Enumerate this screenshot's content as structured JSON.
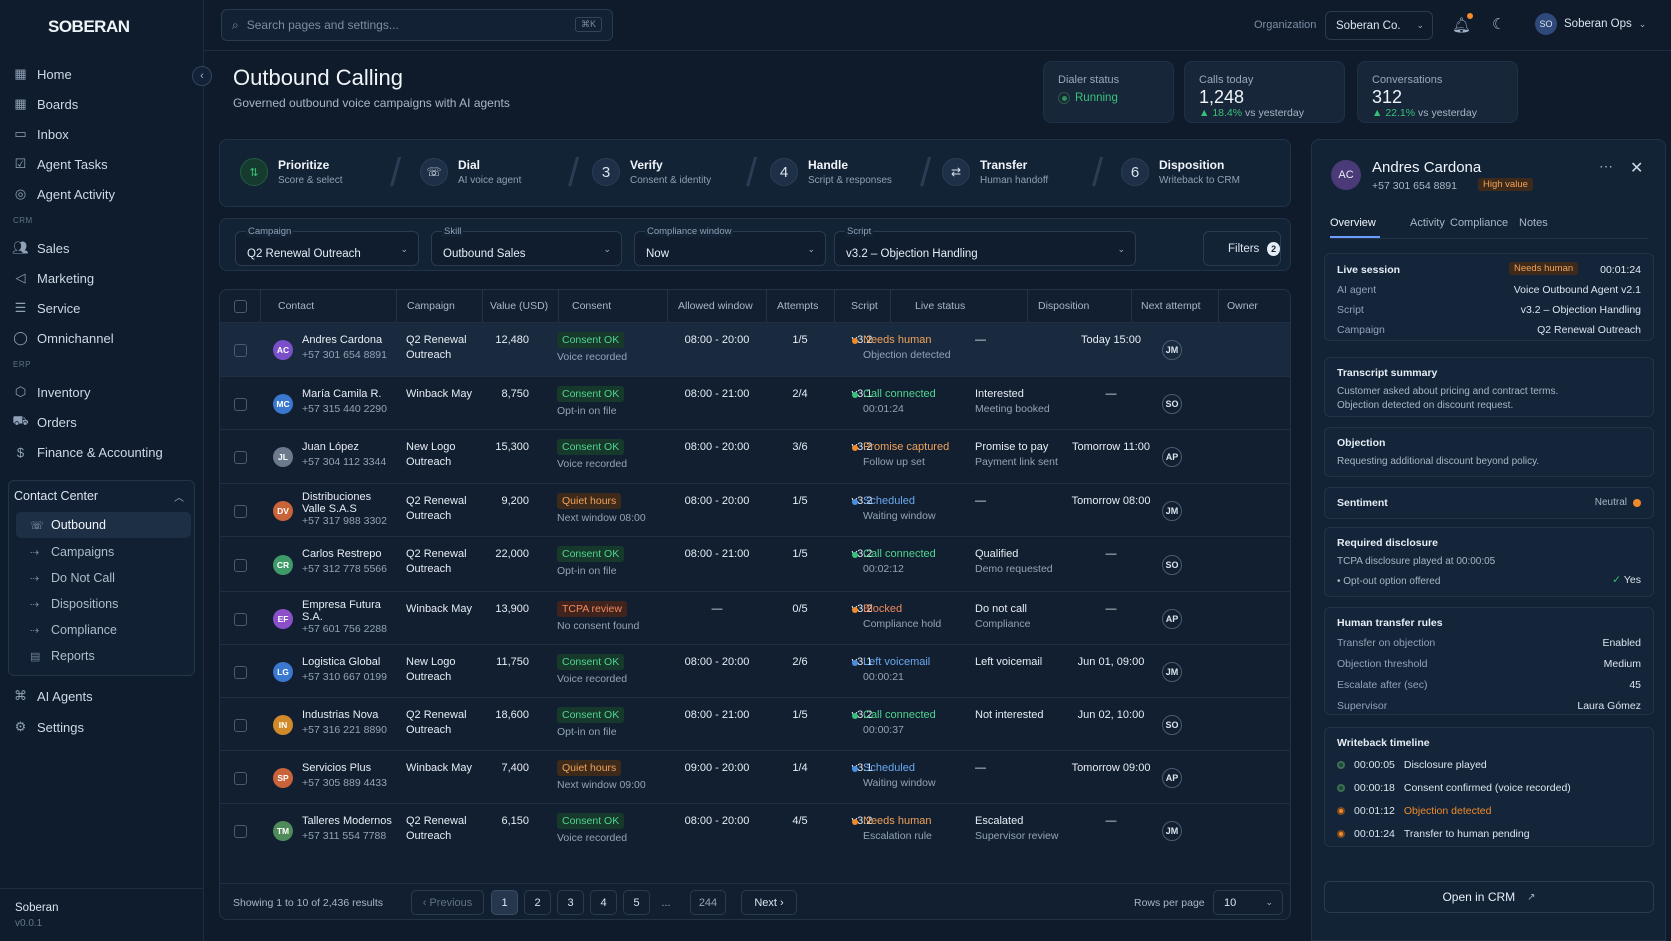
{
  "app": {
    "logo": "SOBERAN"
  },
  "sidebar": {
    "items": [
      {
        "label": "Home",
        "icon": "grid-icon"
      },
      {
        "label": "Boards",
        "icon": "board-icon"
      },
      {
        "label": "Inbox",
        "icon": "inbox-icon"
      },
      {
        "label": "Agent Tasks",
        "icon": "tasks-icon"
      },
      {
        "label": "Agent Activity",
        "icon": "activity-icon"
      }
    ],
    "crm_label": "CRM",
    "crm_items": [
      {
        "label": "Sales"
      },
      {
        "label": "Marketing"
      },
      {
        "label": "Service"
      },
      {
        "label": "Omnichannel"
      }
    ],
    "erp_label": "ERP",
    "erp_items": [
      {
        "label": "Inventory"
      },
      {
        "label": "Orders"
      },
      {
        "label": "Finance & Accounting"
      }
    ],
    "contact_center": {
      "label": "Contact Center",
      "items": [
        {
          "label": "Outbound"
        },
        {
          "label": "Campaigns"
        },
        {
          "label": "Do Not Call"
        },
        {
          "label": "Dispositions"
        },
        {
          "label": "Compliance"
        },
        {
          "label": "Reports"
        }
      ]
    },
    "bottom_items": [
      {
        "label": "AI Agents"
      },
      {
        "label": "Settings"
      }
    ],
    "footer": {
      "name": "Soberan",
      "version": "v0.0.1"
    }
  },
  "topbar": {
    "search_placeholder": "Search pages and settings...",
    "kbd": "⌘K",
    "org_label": "Organization",
    "org_value": "Soberan Co.",
    "user_initials": "SO",
    "user_name": "Soberan Ops"
  },
  "header": {
    "title": "Outbound Calling",
    "subtitle": "Governed outbound voice campaigns with AI agents",
    "dialer": {
      "label": "Dialer status",
      "value": "Running"
    },
    "calls": {
      "label": "Calls today",
      "value": "1,248",
      "delta": "18.4%",
      "delta_text": "vs yesterday"
    },
    "conversations": {
      "label": "Conversations",
      "value": "312",
      "delta": "22.1%",
      "delta_text": "vs yesterday"
    }
  },
  "steps": [
    {
      "num": "",
      "title": "Prioritize",
      "sub": "Score & select"
    },
    {
      "num": "",
      "title": "Dial",
      "sub": "AI voice agent"
    },
    {
      "num": "3",
      "title": "Verify",
      "sub": "Consent & identity"
    },
    {
      "num": "4",
      "title": "Handle",
      "sub": "Script & responses"
    },
    {
      "num": "",
      "title": "Transfer",
      "sub": "Human handoff"
    },
    {
      "num": "6",
      "title": "Disposition",
      "sub": "Writeback to CRM"
    }
  ],
  "filters": {
    "campaign": {
      "label": "Campaign",
      "value": "Q2 Renewal Outreach"
    },
    "skill": {
      "label": "Skill",
      "value": "Outbound Sales"
    },
    "window": {
      "label": "Compliance window",
      "value": "Now"
    },
    "script": {
      "label": "Script",
      "value": "v3.2 – Objection Handling"
    },
    "button": "Filters",
    "count": "2"
  },
  "table": {
    "headers": [
      "Contact",
      "Campaign",
      "Value (USD)",
      "Consent",
      "Allowed window",
      "Attempts",
      "Script",
      "Live status",
      "Disposition",
      "Next attempt",
      "Owner"
    ],
    "rows": [
      {
        "ini": "AC",
        "avc": "#7a4fc9",
        "name": "Andres Cardona",
        "name2": "",
        "phone": "+57 301 654 8891",
        "camp1": "Q2 Renewal",
        "camp2": "Outreach",
        "value": "12,480",
        "consent": "Consent OK",
        "ctype": "ok",
        "csub": "Voice recorded",
        "window": "08:00 - 20:00",
        "att": "1/5",
        "script": "v3.2",
        "status": "Needs human",
        "sc": "#f08a2b",
        "scol": "#f0a25a",
        "ssub": "Objection detected",
        "disp": "—",
        "dsub": "",
        "next": "Today 15:00",
        "owner": "JM"
      },
      {
        "ini": "MC",
        "avc": "#3a78d0",
        "name": "María Camila R.",
        "name2": "",
        "phone": "+57 315 440 2290",
        "camp1": "Winback May",
        "camp2": "",
        "value": "8,750",
        "consent": "Consent OK",
        "ctype": "ok",
        "csub": "Opt-in on file",
        "window": "08:00 - 21:00",
        "att": "2/4",
        "script": "v3.1",
        "status": "Call connected",
        "sc": "#39c07a",
        "scol": "#4fd48f",
        "ssub": "00:01:24",
        "disp": "Interested",
        "dsub": "Meeting booked",
        "next": "—",
        "owner": "SO"
      },
      {
        "ini": "JL",
        "avc": "#6b7a8c",
        "name": "Juan López",
        "name2": "",
        "phone": "+57 304 112 3344",
        "camp1": "New Logo",
        "camp2": "Outreach",
        "value": "15,300",
        "consent": "Consent OK",
        "ctype": "ok",
        "csub": "Voice recorded",
        "window": "08:00 - 20:00",
        "att": "3/6",
        "script": "v3.2",
        "status": "Promise captured",
        "sc": "#f08a2b",
        "scol": "#f0a25a",
        "ssub": "Follow up set",
        "disp": "Promise to pay",
        "dsub": "Payment link sent",
        "next": "Tomorrow 11:00",
        "owner": "AP"
      },
      {
        "ini": "DV",
        "avc": "#c9633a",
        "name": "Distribuciones",
        "name2": "Valle S.A.S",
        "phone": "+57 317 988 3302",
        "camp1": "Q2 Renewal",
        "camp2": "Outreach",
        "value": "9,200",
        "consent": "Quiet hours",
        "ctype": "warn",
        "csub": "Next window 08:00",
        "window": "08:00 - 20:00",
        "att": "1/5",
        "script": "v3.2",
        "status": "Scheduled",
        "sc": "#4a90e2",
        "scol": "#6aa8f0",
        "ssub": "Waiting window",
        "disp": "—",
        "dsub": "",
        "next": "Tomorrow 08:00",
        "owner": "JM"
      },
      {
        "ini": "CR",
        "avc": "#3f9a6a",
        "name": "Carlos Restrepo",
        "name2": "",
        "phone": "+57 312 778 5566",
        "camp1": "Q2 Renewal",
        "camp2": "Outreach",
        "value": "22,000",
        "consent": "Consent OK",
        "ctype": "ok",
        "csub": "Opt-in on file",
        "window": "08:00 - 21:00",
        "att": "1/5",
        "script": "v3.2",
        "status": "Call connected",
        "sc": "#39c07a",
        "scol": "#4fd48f",
        "ssub": "00:02:12",
        "disp": "Qualified",
        "dsub": "Demo requested",
        "next": "—",
        "owner": "SO"
      },
      {
        "ini": "EF",
        "avc": "#8a4fc9",
        "name": "Empresa Futura",
        "name2": "S.A.",
        "phone": "+57 601 756 2288",
        "camp1": "Winback May",
        "camp2": "",
        "value": "13,900",
        "consent": "TCPA review",
        "ctype": "err",
        "csub": "No consent found",
        "window": "—",
        "att": "0/5",
        "script": "v3.2",
        "status": "Blocked",
        "sc": "#f08a2b",
        "scol": "#f08a5c",
        "ssub": "Compliance hold",
        "disp": "Do not call",
        "dsub": "Compliance",
        "next": "—",
        "owner": "AP"
      },
      {
        "ini": "LG",
        "avc": "#3a78d0",
        "name": "Logistica Global",
        "name2": "",
        "phone": "+57 310 667 0199",
        "camp1": "New Logo",
        "camp2": "Outreach",
        "value": "11,750",
        "consent": "Consent OK",
        "ctype": "ok",
        "csub": "Voice recorded",
        "window": "08:00 - 20:00",
        "att": "2/6",
        "script": "v3.1",
        "status": "Left voicemail",
        "sc": "#4a90e2",
        "scol": "#6aa8f0",
        "ssub": "00:00:21",
        "disp": "Left voicemail",
        "dsub": "",
        "next": "Jun 01, 09:00",
        "owner": "JM"
      },
      {
        "ini": "IN",
        "avc": "#d08a2a",
        "name": "Industrias Nova",
        "name2": "",
        "phone": "+57 316 221 8890",
        "camp1": "Q2 Renewal",
        "camp2": "Outreach",
        "value": "18,600",
        "consent": "Consent OK",
        "ctype": "ok",
        "csub": "Opt-in on file",
        "window": "08:00 - 21:00",
        "att": "1/5",
        "script": "v3.2",
        "status": "Call connected",
        "sc": "#39c07a",
        "scol": "#4fd48f",
        "ssub": "00:00:37",
        "disp": "Not interested",
        "dsub": "",
        "next": "Jun 02, 10:00",
        "owner": "SO"
      },
      {
        "ini": "SP",
        "avc": "#c9633a",
        "name": "Servicios Plus",
        "name2": "",
        "phone": "+57 305 889 4433",
        "camp1": "Winback May",
        "camp2": "",
        "value": "7,400",
        "consent": "Quiet hours",
        "ctype": "warn",
        "csub": "Next window 09:00",
        "window": "09:00 - 20:00",
        "att": "1/4",
        "script": "v3.1",
        "status": "Scheduled",
        "sc": "#4a90e2",
        "scol": "#6aa8f0",
        "ssub": "Waiting window",
        "disp": "—",
        "dsub": "",
        "next": "Tomorrow 09:00",
        "owner": "AP"
      },
      {
        "ini": "TM",
        "avc": "#4f8a5a",
        "name": "Talleres Modernos",
        "name2": "",
        "phone": "+57 311 554 7788",
        "camp1": "Q2 Renewal",
        "camp2": "Outreach",
        "value": "6,150",
        "consent": "Consent OK",
        "ctype": "ok",
        "csub": "Voice recorded",
        "window": "08:00 - 20:00",
        "att": "4/5",
        "script": "v3.2",
        "status": "Needs human",
        "sc": "#f08a2b",
        "scol": "#f0a25a",
        "ssub": "Escalation rule",
        "disp": "Escalated",
        "dsub": "Supervisor review",
        "next": "—",
        "owner": "JM"
      }
    ],
    "footer_text": "Showing 1 to 10 of 2,436 results",
    "prev": "Previous",
    "pages": [
      "1",
      "2",
      "3",
      "4",
      "5",
      "...",
      "244"
    ],
    "next": "Next",
    "rows_label": "Rows per page",
    "rows_value": "10"
  },
  "panel": {
    "initials": "AC",
    "name": "Andres Cardona",
    "phone": "+57 301 654 8891",
    "badge": "High value",
    "tabs": [
      "Overview",
      "Activity",
      "Compliance",
      "Notes"
    ],
    "live": {
      "title": "Live session",
      "badge": "Needs human",
      "time": "00:01:24",
      "rows": [
        {
          "k": "AI agent",
          "v": "Voice Outbound Agent v2.1"
        },
        {
          "k": "Script",
          "v": "v3.2 – Objection Handling"
        },
        {
          "k": "Campaign",
          "v": "Q2 Renewal Outreach"
        }
      ]
    },
    "transcript": {
      "title": "Transcript summary",
      "line1": "Customer asked about pricing and contract terms.",
      "line2": "Objection detected on discount request."
    },
    "objection": {
      "title": "Objection",
      "text": "Requesting additional discount beyond policy."
    },
    "sentiment": {
      "title": "Sentiment",
      "value": "Neutral"
    },
    "disclosure": {
      "title": "Required disclosure",
      "line1": "TCPA disclosure played at 00:00:05",
      "line2": "Opt-out option offered",
      "value": "Yes"
    },
    "transfer": {
      "title": "Human transfer rules",
      "rows": [
        {
          "k": "Transfer on objection",
          "v": "Enabled"
        },
        {
          "k": "Objection threshold",
          "v": "Medium"
        },
        {
          "k": "Escalate after (sec)",
          "v": "45"
        },
        {
          "k": "Supervisor",
          "v": "Laura Gómez"
        }
      ]
    },
    "timeline": {
      "title": "Writeback timeline",
      "items": [
        {
          "t": "00:00:05",
          "text": "Disclosure played",
          "warn": false
        },
        {
          "t": "00:00:18",
          "text": "Consent confirmed (voice recorded)",
          "warn": false
        },
        {
          "t": "00:01:12",
          "text": "Objection detected",
          "warn": true
        },
        {
          "t": "00:01:24",
          "text": "Transfer to human pending",
          "warn": true
        }
      ]
    },
    "open_crm": "Open in CRM"
  },
  "colors": {
    "accent": "#6b9cff",
    "ok": "#39c07a",
    "warn": "#f08a2b",
    "bg": "#0f1b2b"
  }
}
